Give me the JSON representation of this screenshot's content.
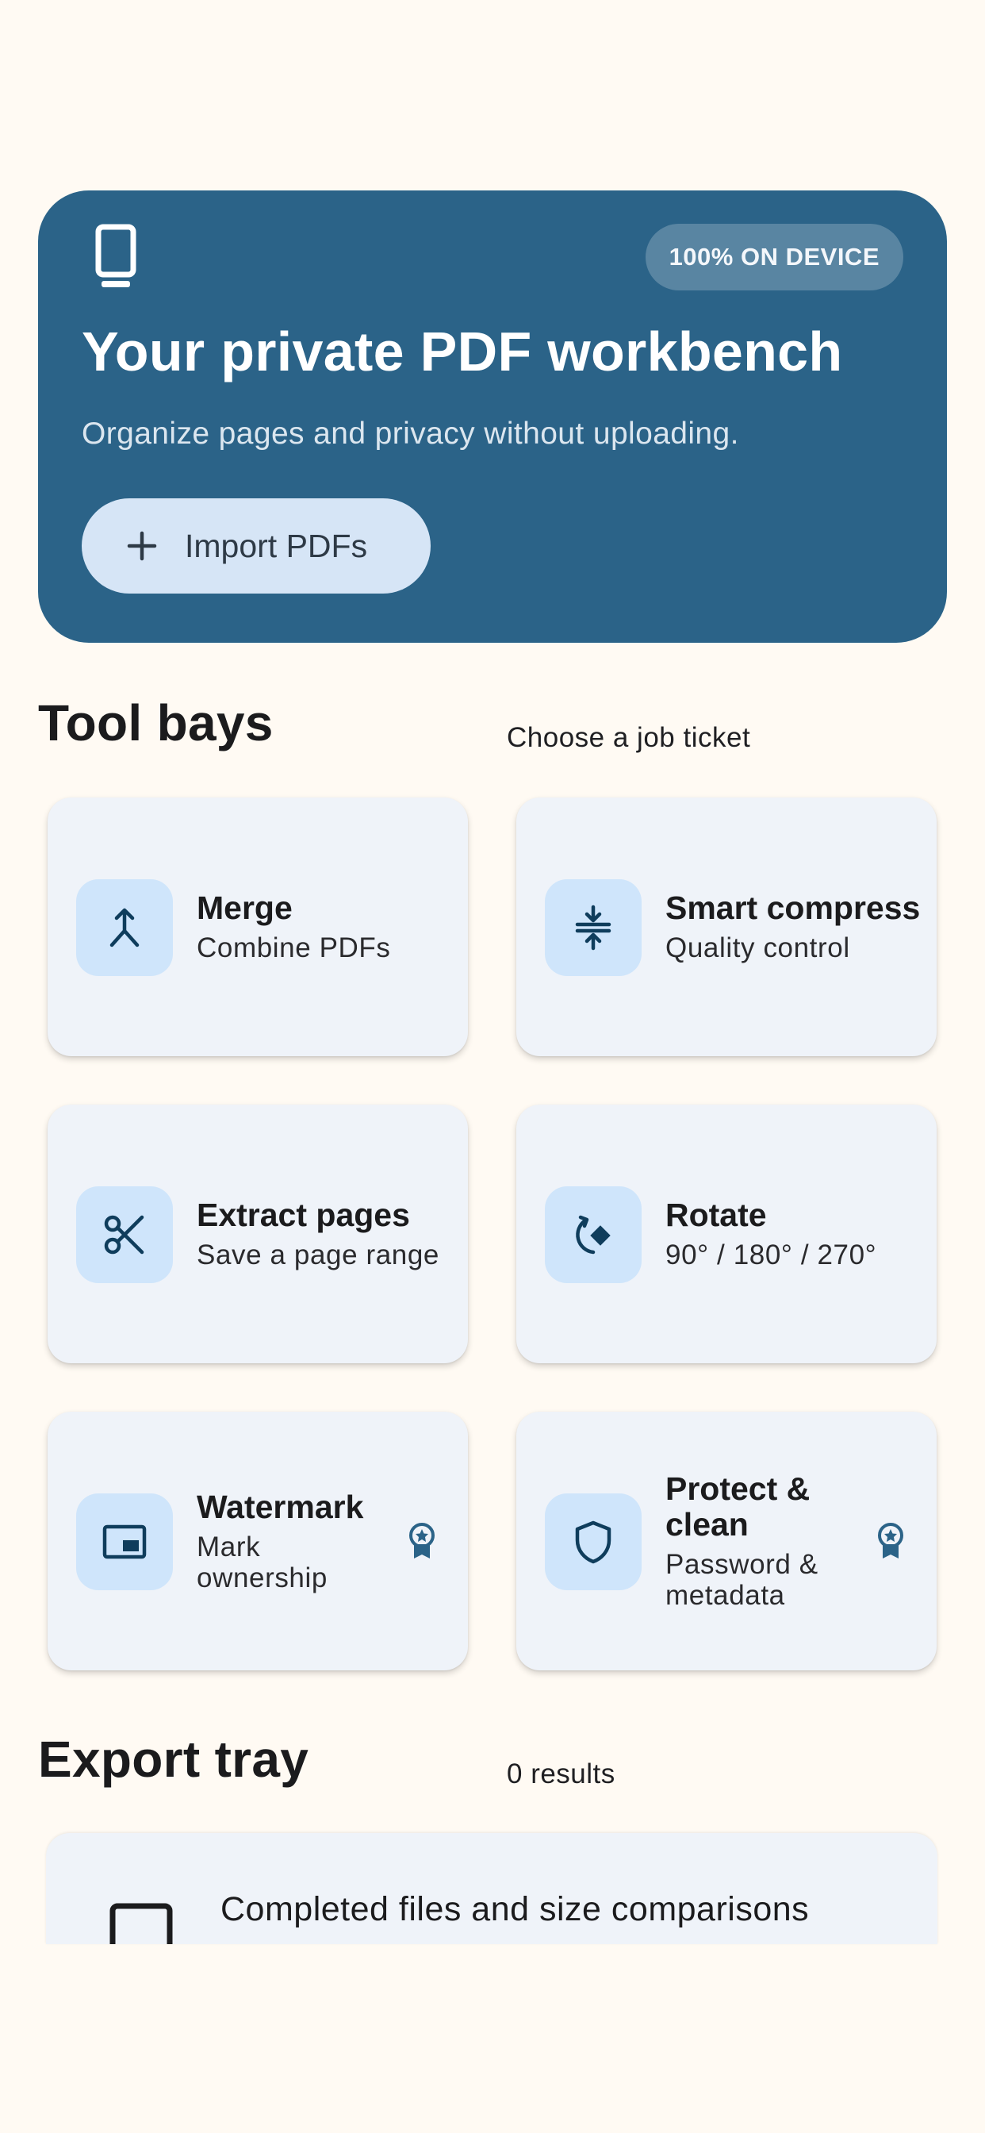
{
  "hero": {
    "icon": "smartphone-icon",
    "badge": "100% ON DEVICE",
    "title": "Your private PDF workbench",
    "subtitle": "Organize pages and privacy without uploading.",
    "import_label": "Import PDFs"
  },
  "tools": {
    "title": "Tool bays",
    "meta": "Choose a job ticket",
    "items": [
      {
        "name": "Merge",
        "desc": "Combine PDFs",
        "icon": "merge-icon"
      },
      {
        "name": "Smart compress",
        "desc": "Quality control",
        "icon": "compress-icon"
      },
      {
        "name": "Extract pages",
        "desc": "Save a page range",
        "icon": "scissors-icon"
      },
      {
        "name": "Rotate",
        "desc": "90° / 180° / 270°",
        "icon": "rotate-icon"
      },
      {
        "name": "Watermark",
        "desc": "Mark ownership",
        "icon": "watermark-icon",
        "premium": true
      },
      {
        "name": "Protect & clean",
        "desc": "Password & metadata",
        "icon": "shield-icon",
        "premium": true
      }
    ]
  },
  "export": {
    "title": "Export tray",
    "meta": "0 results",
    "caption": "Completed files and size comparisons"
  },
  "colors": {
    "background": "#fffaf3",
    "hero": "#2b6388",
    "card": "#eff3f9",
    "icon_tile": "#cfe5fb",
    "icon_stroke": "#0f3d5c"
  }
}
